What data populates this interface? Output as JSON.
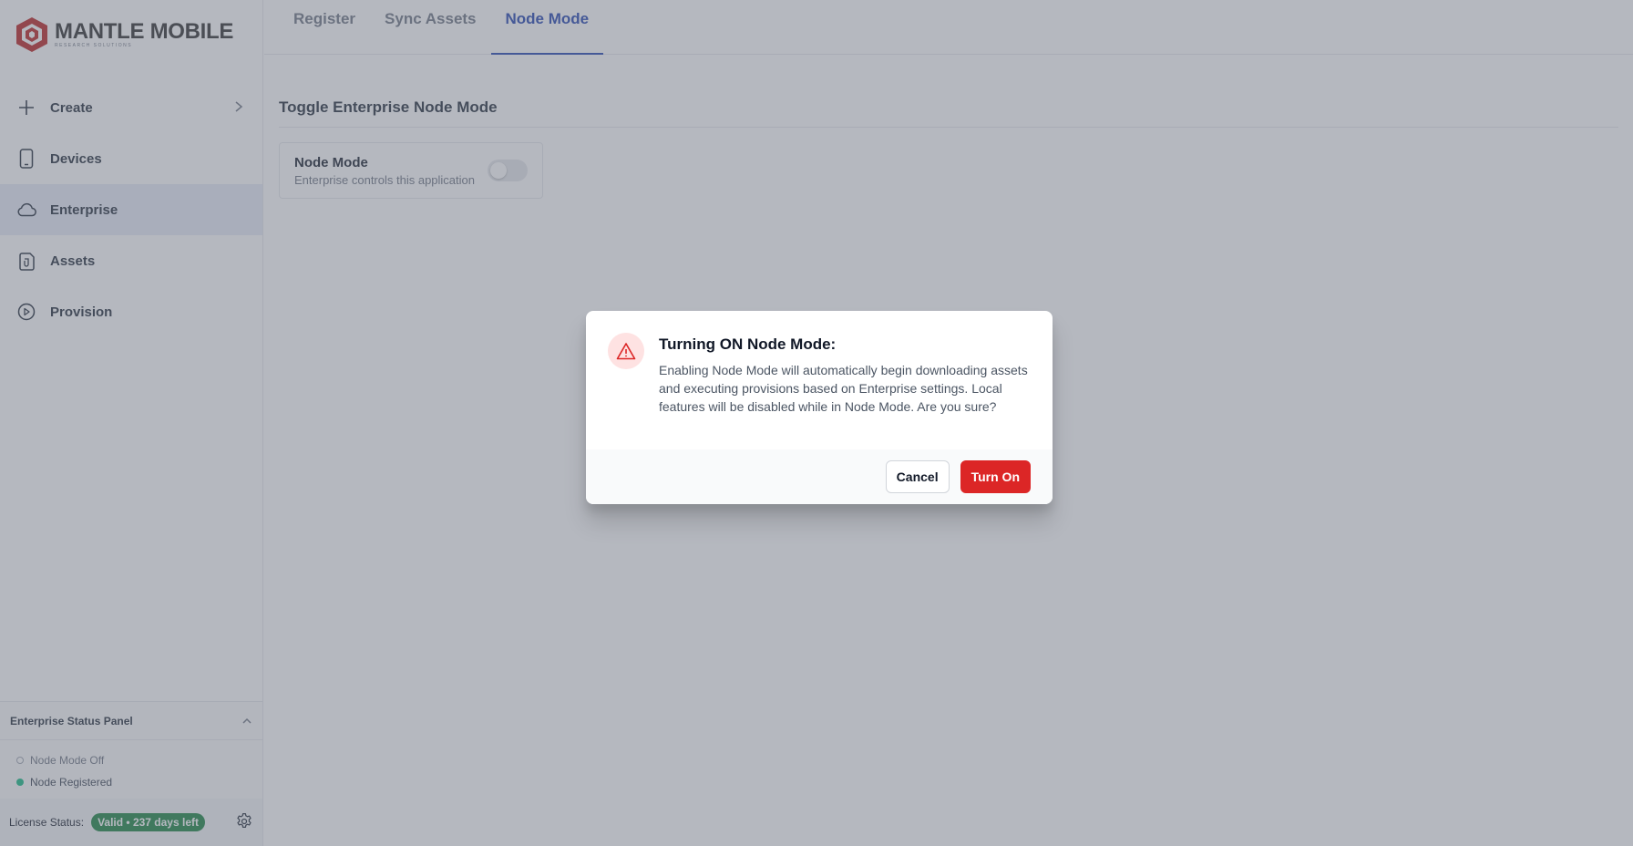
{
  "brand": {
    "title_part1": "MANTLE",
    "title_part2": "MOBILE",
    "subtitle": "RESEARCH SOLUTIONS",
    "accent": "#b91c1c"
  },
  "sidebar": {
    "items": [
      {
        "label": "Create",
        "icon": "plus-icon",
        "has_chevron": true,
        "active": false
      },
      {
        "label": "Devices",
        "icon": "phone-icon",
        "active": false
      },
      {
        "label": "Enterprise",
        "icon": "cloud-icon",
        "active": true
      },
      {
        "label": "Assets",
        "icon": "file-copy-icon",
        "active": false
      },
      {
        "label": "Provision",
        "icon": "play-circle-icon",
        "active": false
      }
    ],
    "status_panel": {
      "title": "Enterprise Status Panel",
      "rows": [
        {
          "label": "Node Mode Off",
          "state": "off"
        },
        {
          "label": "Node Registered",
          "state": "on"
        }
      ]
    },
    "license": {
      "label": "License Status:",
      "badge": "Valid • 237 days left",
      "badge_color": "#15803d"
    }
  },
  "tabs": [
    {
      "label": "Register",
      "active": false
    },
    {
      "label": "Sync Assets",
      "active": false
    },
    {
      "label": "Node Mode",
      "active": true
    }
  ],
  "main": {
    "section_title": "Toggle Enterprise Node Mode",
    "card": {
      "title": "Node Mode",
      "subtitle": "Enterprise controls this application",
      "toggle_on": false
    }
  },
  "modal": {
    "title": "Turning ON Node Mode:",
    "description": "Enabling Node Mode will automatically begin downloading assets and executing provisions based on Enterprise settings. Local features will be disabled while in Node Mode. Are you sure?",
    "cancel_label": "Cancel",
    "confirm_label": "Turn On",
    "confirm_color": "#dc2626"
  }
}
